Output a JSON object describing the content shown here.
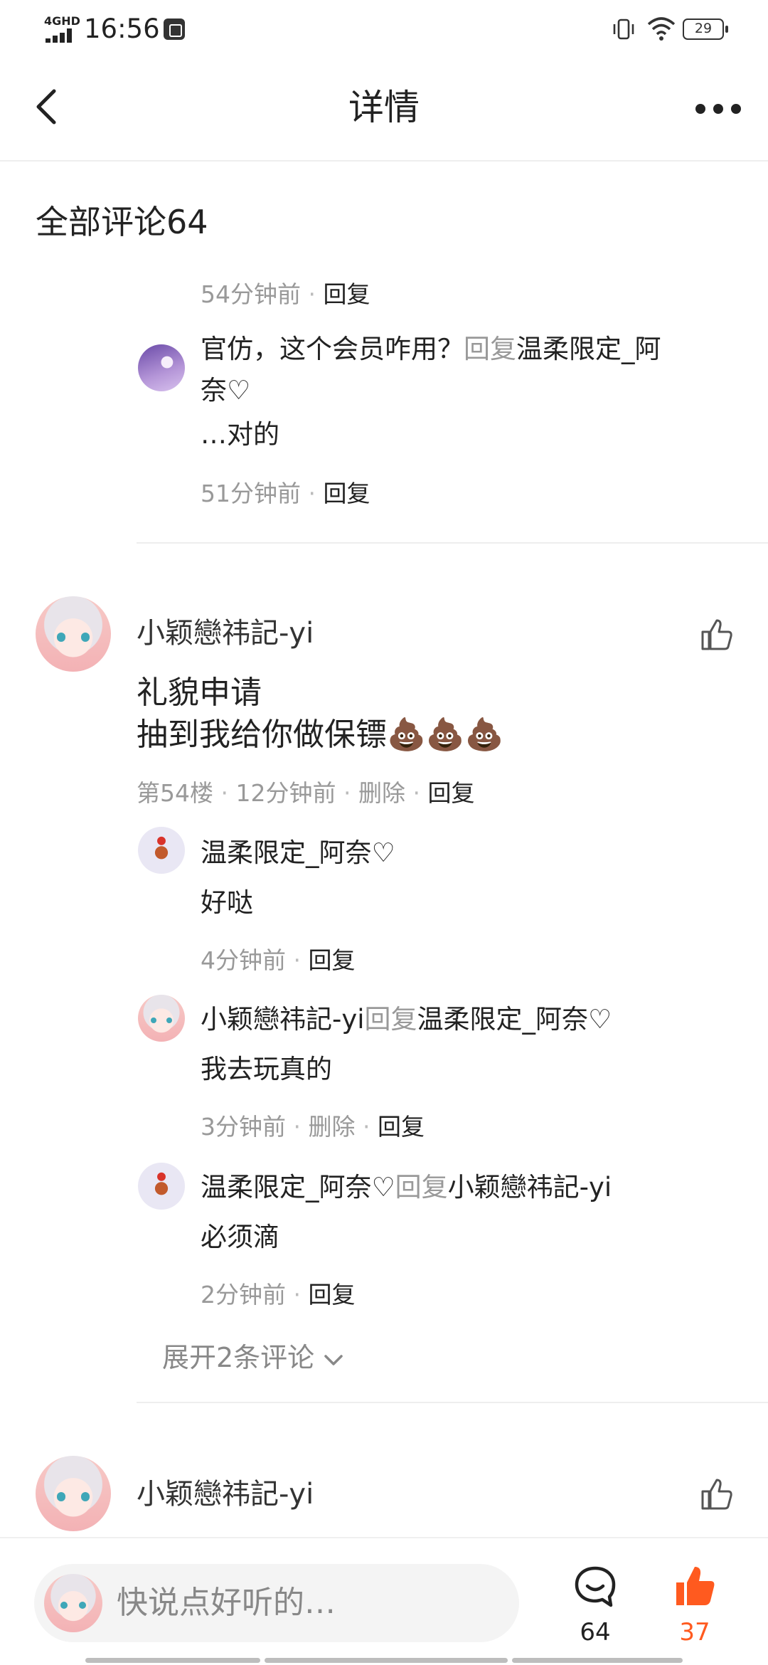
{
  "status_bar": {
    "network": "4GHD",
    "time": "16:56",
    "battery": "29"
  },
  "nav": {
    "title": "详情"
  },
  "comments_header": "全部评论64",
  "thread1": {
    "prev_meta": {
      "time": "54分钟前",
      "reply": "回复"
    },
    "reply1": {
      "line1_a": "官仿，这个会员咋用？",
      "line1_reply": "回复",
      "line1_target": "温柔限定_阿",
      "line2": "奈♡",
      "line3": "…对的",
      "meta": {
        "time": "51分钟前",
        "reply": "回复"
      }
    }
  },
  "comment54": {
    "username": "小颖戀祎記-yi",
    "text_line1": "礼貌申请",
    "text_line2": "抽到我给你做保镖💩💩💩",
    "meta": {
      "floor": "第54楼",
      "time": "12分钟前",
      "delete": "删除",
      "reply": "回复"
    },
    "replies": [
      {
        "name": "温柔限定_阿奈♡",
        "reply_word": "",
        "target": "",
        "text": "好哒",
        "time": "4分钟前",
        "delete": "",
        "reply": "回复"
      },
      {
        "name": "小颖戀祎記-yi",
        "reply_word": "回复",
        "target": "温柔限定_阿奈♡",
        "text": "我去玩真的",
        "time": "3分钟前",
        "delete": "删除",
        "reply": "回复"
      },
      {
        "name": "温柔限定_阿奈♡",
        "reply_word": "回复",
        "target": "小颖戀祎記-yi",
        "text": "必须滴",
        "time": "2分钟前",
        "delete": "",
        "reply": "回复"
      }
    ],
    "expand_label": "展开2条评论"
  },
  "comment_next": {
    "username": "小颖戀祎記-yi"
  },
  "bottom_bar": {
    "input_placeholder": "快说点好听的…",
    "comment_count": "64",
    "like_count": "37"
  },
  "colors": {
    "accent": "#ff5a1f",
    "muted": "#999999",
    "text": "#222222"
  },
  "icons": [
    "back-arrow-icon",
    "more-icon",
    "like-icon",
    "comment-bubble-icon",
    "thumb-up-filled-icon",
    "chevron-down-icon"
  ]
}
